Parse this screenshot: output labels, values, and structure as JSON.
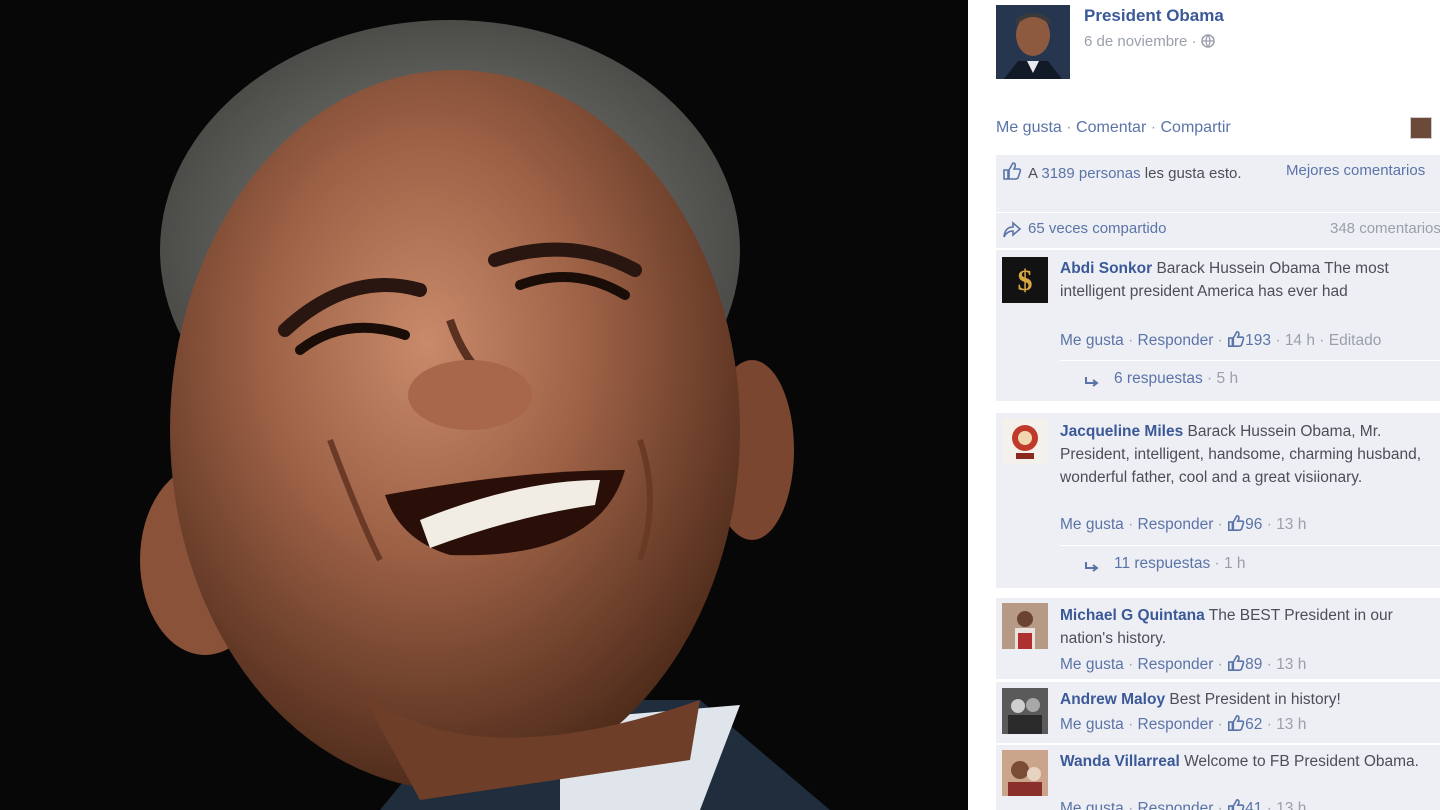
{
  "post": {
    "author": "President Obama",
    "date": "6 de noviembre",
    "actions": {
      "like": "Me gusta",
      "comment": "Comentar",
      "share": "Compartir",
      "sep": " · "
    },
    "likes_text_before": "A ",
    "likes_count": "3189 personas",
    "likes_text_after": " les gusta esto.",
    "best_comments": "Mejores comentarios",
    "shares": "65 veces compartido",
    "comments_count": "348 comentarios"
  },
  "comments": [
    {
      "name": "Abdi Sonkor",
      "text": "Barack Hussein Obama The most intelligent president America has ever had",
      "like": "Me gusta",
      "reply": "Responder",
      "likes": "193",
      "time": "14 h",
      "edited": "Editado",
      "replies": "6 respuestas",
      "replies_time": "5 h"
    },
    {
      "name": "Jacqueline Miles",
      "text": "Barack Hussein Obama, Mr. President, intelligent, handsome, charming husband, wonderful father, cool and a great visiionary.",
      "like": "Me gusta",
      "reply": "Responder",
      "likes": "96",
      "time": "13 h",
      "replies": "11 respuestas",
      "replies_time": "1 h"
    },
    {
      "name": "Michael G Quintana",
      "text": "The BEST President in our nation's history.",
      "like": "Me gusta",
      "reply": "Responder",
      "likes": "89",
      "time": "13 h"
    },
    {
      "name": "Andrew Maloy",
      "text": "Best President in history!",
      "like": "Me gusta",
      "reply": "Responder",
      "likes": "62",
      "time": "13 h"
    },
    {
      "name": "Wanda Villarreal",
      "text": "Welcome to FB President Obama.",
      "like": "Me gusta",
      "reply": "Responder",
      "likes": "41",
      "time": "13 h"
    }
  ],
  "icons": {
    "globe": "globe-icon",
    "thumbs_up": "thumbs-up-icon",
    "share": "share-arrow-icon",
    "reply_arrow": "reply-arrow-icon"
  },
  "colors": {
    "link": "#3b5998",
    "muted": "#9aa0ab",
    "panel_bg": "#edeff4",
    "photo_bg": "#070707"
  }
}
